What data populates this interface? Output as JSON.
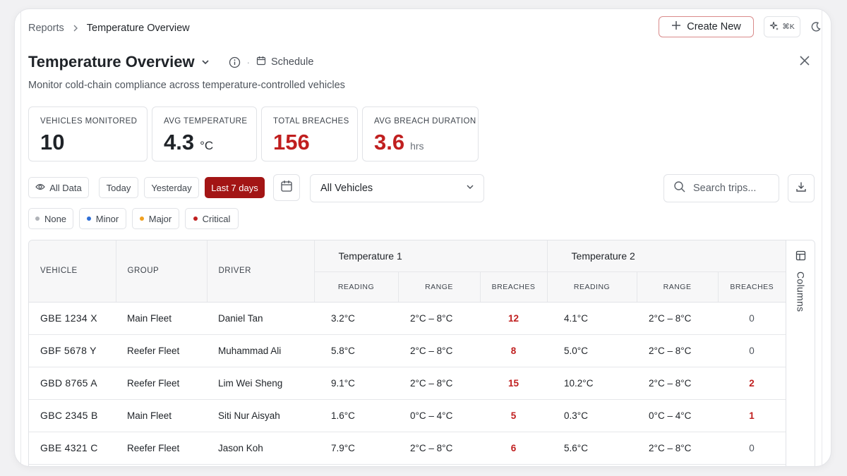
{
  "breadcrumb": {
    "parent": "Reports",
    "current": "Temperature Overview"
  },
  "header": {
    "create_label": "Create New",
    "shortcut": "⌘K"
  },
  "page": {
    "title": "Temperature Overview",
    "schedule_label": "Schedule",
    "subtitle": "Monitor cold-chain compliance across temperature-controlled vehicles"
  },
  "stats": [
    {
      "label": "VEHICLES MONITORED",
      "value": "10",
      "unit": ""
    },
    {
      "label": "AVG TEMPERATURE",
      "value": "4.3",
      "unit": "°C"
    },
    {
      "label": "TOTAL BREACHES",
      "value": "156",
      "unit": ""
    },
    {
      "label": "AVG BREACH DURATION",
      "value": "3.6",
      "unit": "hrs"
    }
  ],
  "filters": {
    "all_data": "All Data",
    "today": "Today",
    "yesterday": "Yesterday",
    "last7": "Last 7 days",
    "vehicle_select": "All Vehicles",
    "search_placeholder": "Search trips..."
  },
  "severity": [
    {
      "label": "None",
      "color": "#b0b3b8"
    },
    {
      "label": "Minor",
      "color": "#2f6fd6"
    },
    {
      "label": "Major",
      "color": "#f0a020"
    },
    {
      "label": "Critical",
      "color": "#c01f1f"
    }
  ],
  "table": {
    "headers": {
      "vehicle": "VEHICLE",
      "group": "GROUP",
      "driver": "DRIVER",
      "temp1": "Temperature 1",
      "temp2": "Temperature 2",
      "reading": "READING",
      "range": "RANGE",
      "breaches": "BREACHES"
    },
    "columns_label": "Columns",
    "rows": [
      {
        "vehicle": "GBE 1234 X",
        "group": "Main Fleet",
        "driver": "Daniel Tan",
        "t1_reading": "3.2°C",
        "t1_range": "2°C – 8°C",
        "t1_breaches": "12",
        "t2_reading": "4.1°C",
        "t2_range": "2°C – 8°C",
        "t2_breaches": "0"
      },
      {
        "vehicle": "GBF 5678 Y",
        "group": "Reefer Fleet",
        "driver": "Muhammad Ali",
        "t1_reading": "5.8°C",
        "t1_range": "2°C – 8°C",
        "t1_breaches": "8",
        "t2_reading": "5.0°C",
        "t2_range": "2°C – 8°C",
        "t2_breaches": "0"
      },
      {
        "vehicle": "GBD 8765 A",
        "group": "Reefer Fleet",
        "driver": "Lim Wei Sheng",
        "t1_reading": "9.1°C",
        "t1_range": "2°C – 8°C",
        "t1_breaches": "15",
        "t2_reading": "10.2°C",
        "t2_range": "2°C – 8°C",
        "t2_breaches": "2"
      },
      {
        "vehicle": "GBC 2345 B",
        "group": "Main Fleet",
        "driver": "Siti Nur Aisyah",
        "t1_reading": "1.6°C",
        "t1_range": "0°C – 4°C",
        "t1_breaches": "5",
        "t2_reading": "0.3°C",
        "t2_range": "0°C – 4°C",
        "t2_breaches": "1"
      },
      {
        "vehicle": "GBE 4321 C",
        "group": "Reefer Fleet",
        "driver": "Jason Koh",
        "t1_reading": "7.9°C",
        "t1_range": "2°C – 8°C",
        "t1_breaches": "6",
        "t2_reading": "5.6°C",
        "t2_range": "2°C – 8°C",
        "t2_breaches": "0"
      }
    ]
  }
}
